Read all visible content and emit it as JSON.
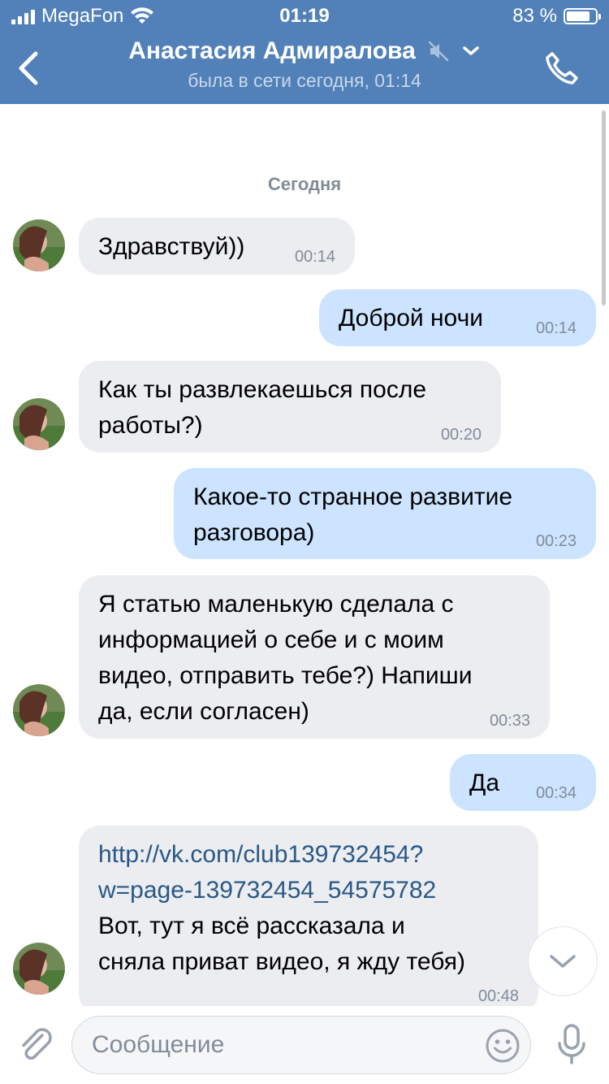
{
  "status": {
    "carrier": "MegaFon",
    "time": "01:19",
    "battery": "83 %",
    "battery_level": 0.83
  },
  "header": {
    "name": "Анастасия Адмиралова",
    "last_seen": "была в сети сегодня, 01:14"
  },
  "chat": {
    "date": "Сегодня",
    "messages": [
      {
        "dir": "in",
        "text": "Здравствуй))",
        "time": "00:14"
      },
      {
        "dir": "out",
        "text": "Доброй ночи",
        "time": "00:14"
      },
      {
        "dir": "in",
        "line1": "Как ты развлекаешься после",
        "line2": "работы?)",
        "time": "00:20"
      },
      {
        "dir": "out",
        "line1": "Какое-то странное развитие",
        "line2": "разговора)",
        "time": "00:23"
      },
      {
        "dir": "in",
        "line1": "Я статью маленькую сделала с",
        "line2": "информацией о себе и с моим",
        "line3": "видео, отправить тебе?) Напиши",
        "line4": "да, если согласен)",
        "time": "00:33"
      },
      {
        "dir": "out",
        "text": "Да",
        "time": "00:34"
      },
      {
        "dir": "in",
        "link1": "http://vk.com/club139732454?",
        "link2": "w=page-139732454_54575782",
        "line1": "Вот, тут я всё рассказала и",
        "line2": "сняла приват видео, я жду тебя)",
        "time": "00:48"
      }
    ]
  },
  "composer": {
    "placeholder": "Сообщение"
  },
  "colors": {
    "header": "#5181b8",
    "incoming": "#ebedf0",
    "outgoing": "#cce4ff",
    "link": "#2a5885",
    "meta": "#818c99"
  }
}
